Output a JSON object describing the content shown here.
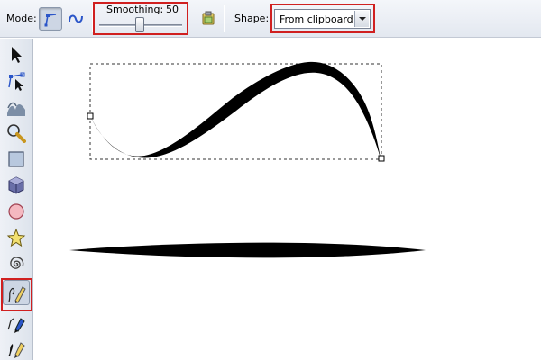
{
  "tool_controls": {
    "mode_label": "Mode:",
    "smoothing_label": "Smoothing:",
    "smoothing_value": "50",
    "shape_label": "Shape:",
    "shape_selected": "From clipboard"
  },
  "highlight_color": "#d02020",
  "toolbox": {
    "tools": [
      {
        "name": "selector",
        "icon": "arrow-pointer-icon"
      },
      {
        "name": "node-editor",
        "icon": "node-edit-icon"
      },
      {
        "name": "tweak",
        "icon": "tweak-icon"
      },
      {
        "name": "zoom",
        "icon": "magnifier-icon"
      },
      {
        "name": "rectangle",
        "icon": "rectangle-icon"
      },
      {
        "name": "3d-box",
        "icon": "3d-box-icon"
      },
      {
        "name": "ellipse",
        "icon": "circle-icon"
      },
      {
        "name": "star",
        "icon": "star-icon"
      },
      {
        "name": "spiral",
        "icon": "spiral-icon"
      },
      {
        "name": "pencil",
        "icon": "pencil-icon",
        "active": true
      },
      {
        "name": "pen",
        "icon": "pen-icon"
      },
      {
        "name": "calligraphy",
        "icon": "calligraphy-icon"
      }
    ]
  }
}
